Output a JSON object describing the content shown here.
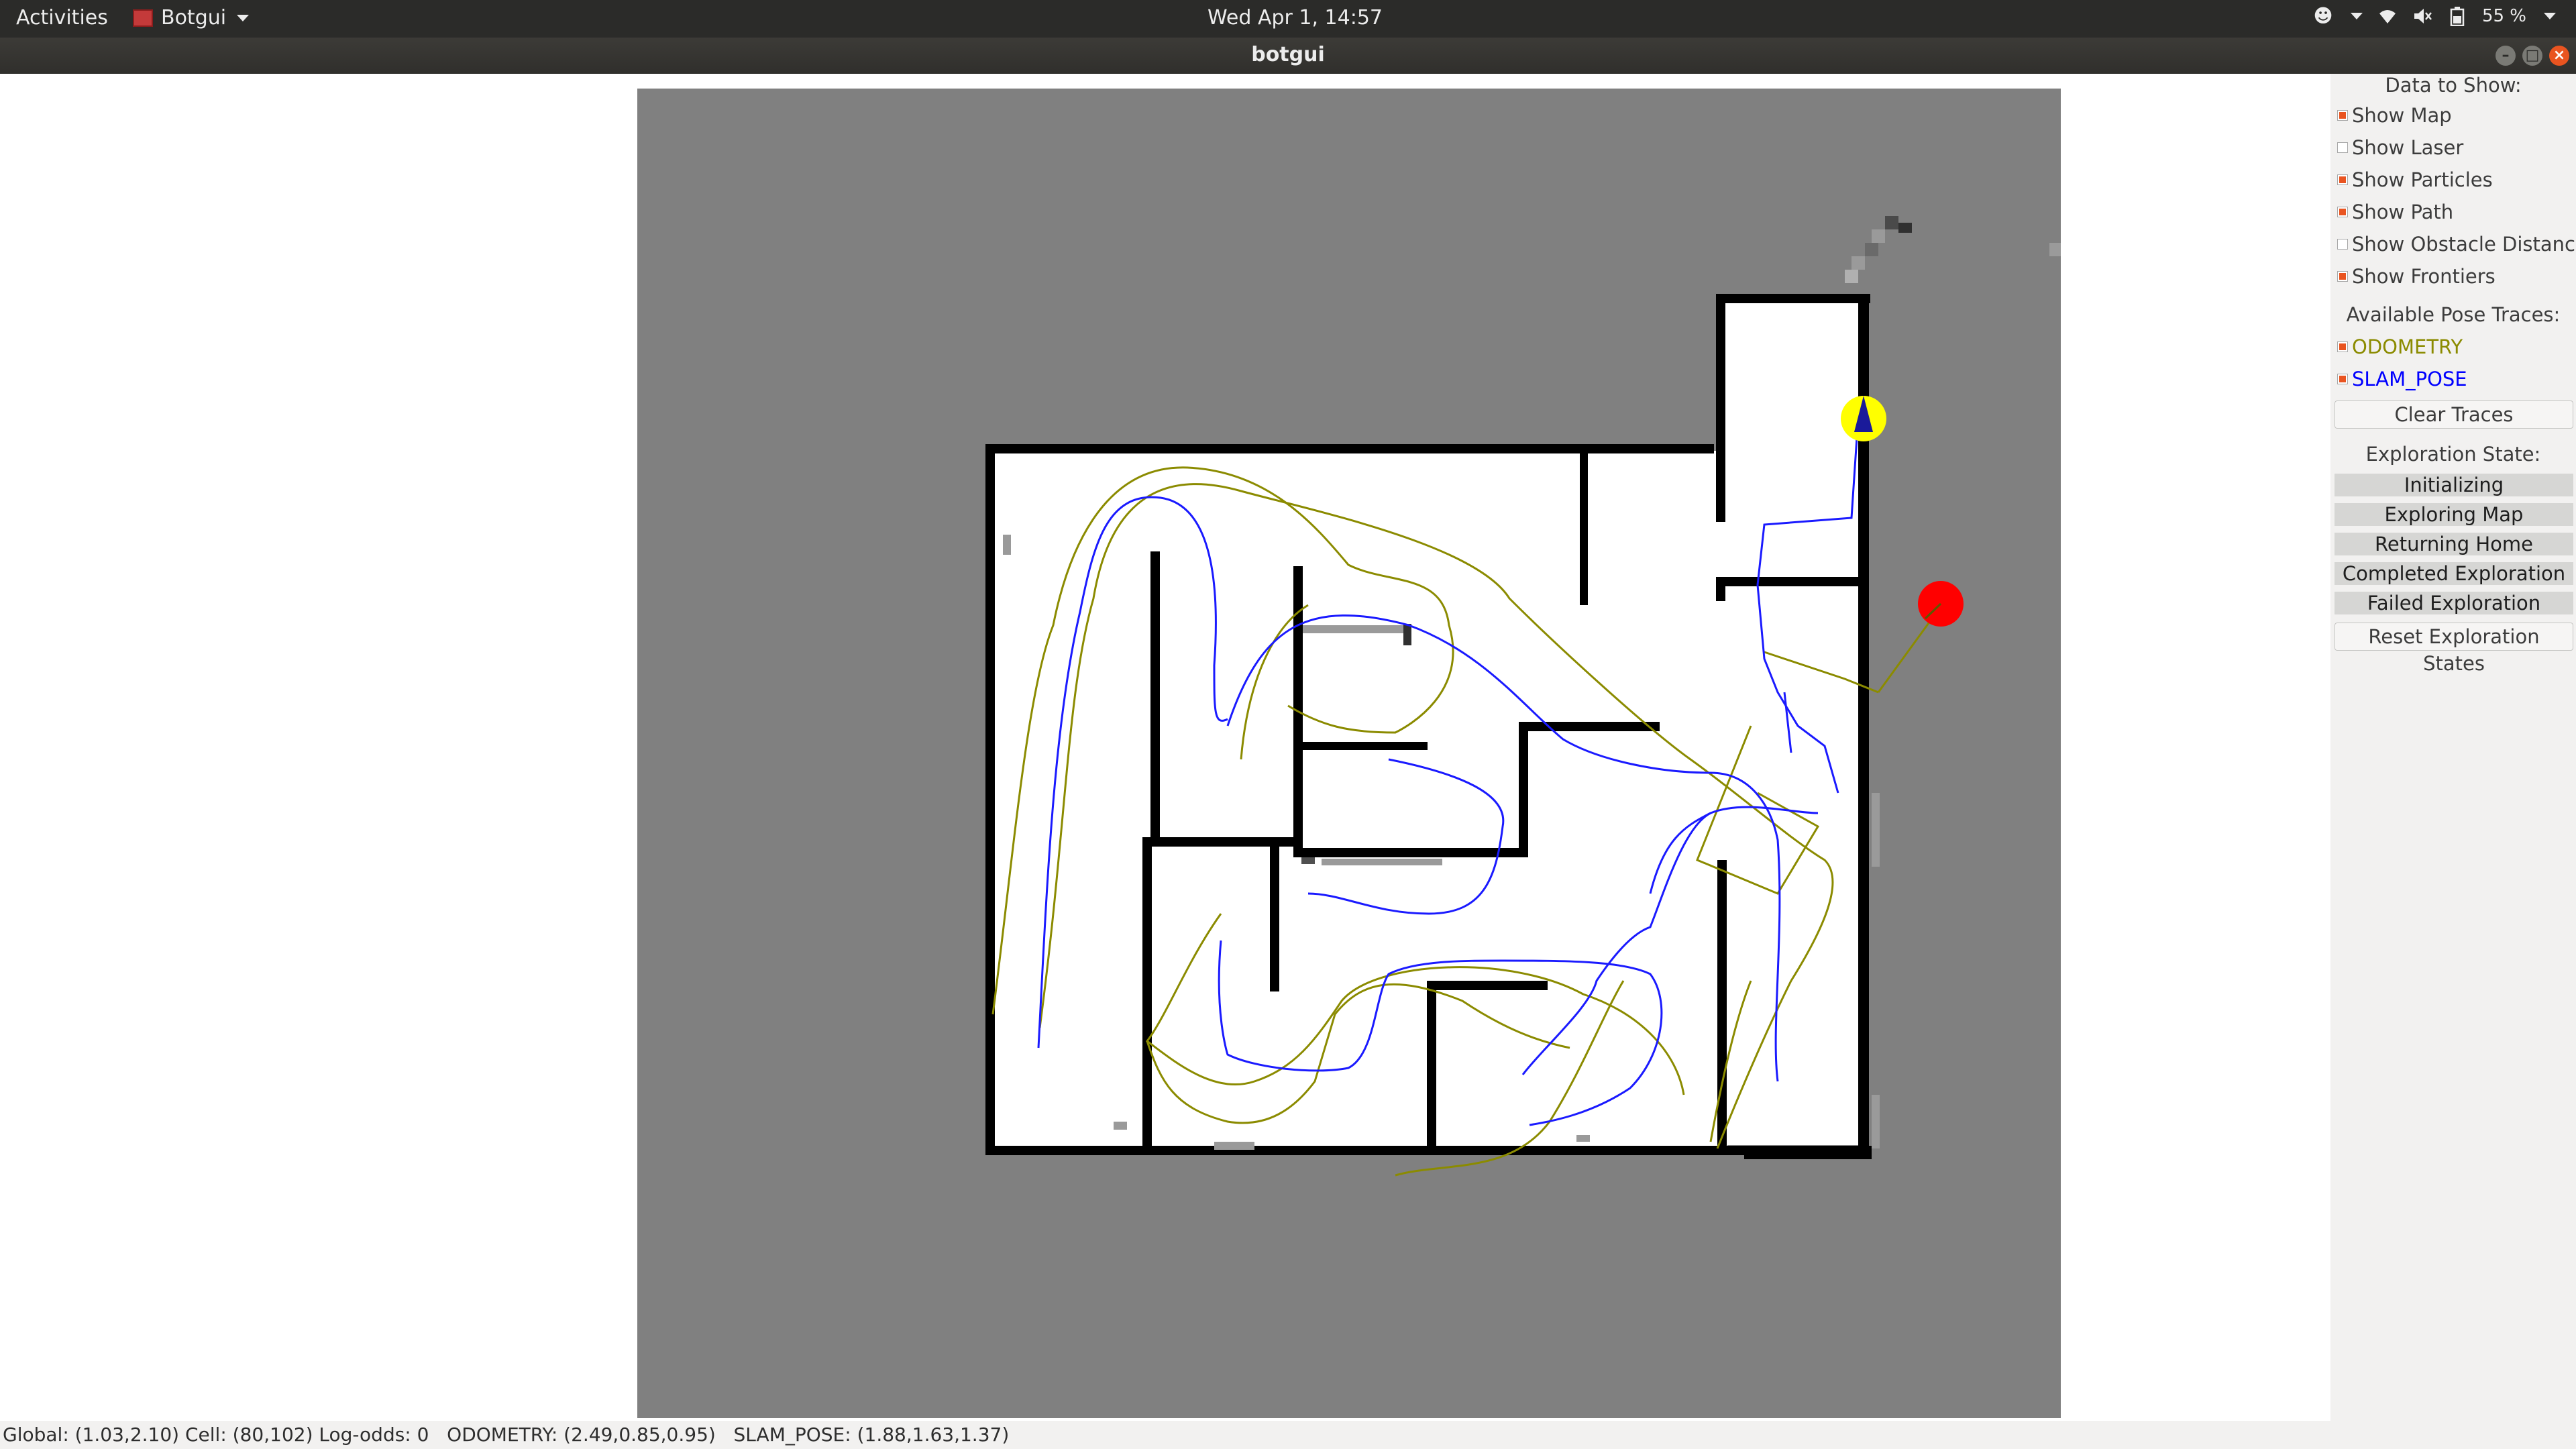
{
  "topbar": {
    "activities": "Activities",
    "app_name": "Botgui",
    "clock": "Wed Apr  1, 14:57",
    "battery": "55 %",
    "icons": [
      "accessibility-icon",
      "wifi-icon",
      "volume-mute-icon",
      "battery-icon"
    ]
  },
  "window": {
    "title": "botgui"
  },
  "panel": {
    "data_header": "Data to Show:",
    "options": [
      {
        "label": "Show Map",
        "checked": true
      },
      {
        "label": "Show Laser",
        "checked": false
      },
      {
        "label": "Show Particles",
        "checked": true
      },
      {
        "label": "Show Path",
        "checked": true
      },
      {
        "label": "Show Obstacle Distances",
        "checked": false
      },
      {
        "label": "Show Frontiers",
        "checked": true
      }
    ],
    "traces_header": "Available Pose Traces:",
    "traces": [
      {
        "label": "ODOMETRY",
        "checked": true,
        "color": "#8b8b00"
      },
      {
        "label": "SLAM_POSE",
        "checked": true,
        "color": "#0000ff"
      }
    ],
    "clear_traces": "Clear Traces",
    "exploration_header": "Exploration State:",
    "states": [
      "Initializing",
      "Exploring Map",
      "Returning Home",
      "Completed Exploration",
      "Failed Exploration"
    ],
    "reset_button": "Reset Exploration States"
  },
  "map": {
    "colors": {
      "unknown": "#808080",
      "free": "#ffffff",
      "occupied": "#000000",
      "odometry": "#8b8b00",
      "slam_pose": "#1a1aff",
      "robot": "#ffff00",
      "goal": "#ff0000"
    }
  },
  "statusbar": {
    "global": "Global: (1.03,2.10)",
    "cell": "Cell: (80,102)",
    "logodds": "Log-odds: 0",
    "odometry": "ODOMETRY: (2.49,0.85,0.95)",
    "slam_pose": "SLAM_POSE: (1.88,1.63,1.37)"
  }
}
